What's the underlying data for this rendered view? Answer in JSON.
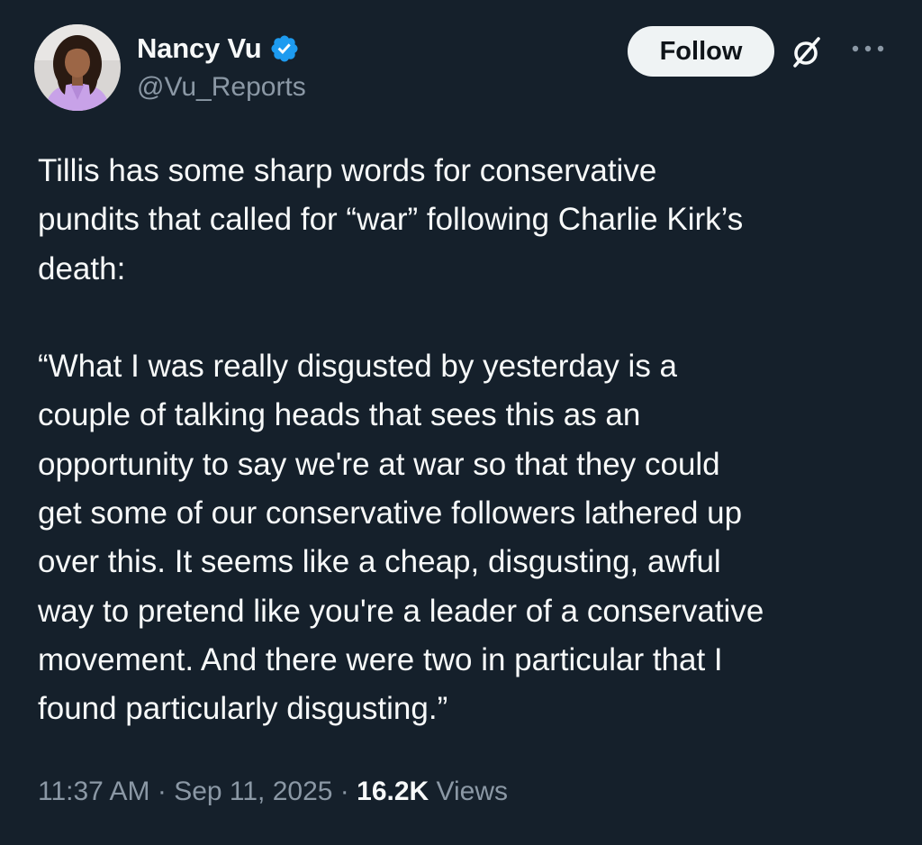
{
  "author": {
    "display_name": "Nancy Vu",
    "handle": "@Vu_Reports",
    "verified": true,
    "verified_color": "#1d9bf0"
  },
  "actions": {
    "follow_label": "Follow",
    "grok_icon": "grok-icon",
    "more_icon": "more-icon"
  },
  "tweet": {
    "text": "Tillis has some sharp words for conservative\npundits that called for “war” following Charlie Kirk’s\ndeath:\n\n“What I was really disgusted by yesterday is a\ncouple of talking heads that sees this as an\nopportunity to say we're at war so that they could\nget some of our conservative followers lathered up\nover this. It seems like a cheap, disgusting, awful\nway to pretend like you're a leader of a conservative\nmovement. And there were two in particular that I\nfound particularly disgusting.”"
  },
  "meta": {
    "time": "11:37 AM",
    "separator": " · ",
    "date": "Sep 11, 2025",
    "views_count": "16.2K",
    "views_label": " Views"
  },
  "colors": {
    "background": "#15202b",
    "primary_text": "#f7f9f9",
    "secondary_text": "#8b98a5",
    "follow_button_bg": "#eff3f4"
  }
}
